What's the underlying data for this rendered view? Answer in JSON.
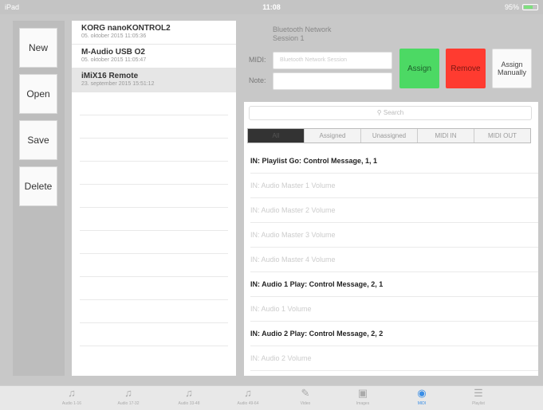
{
  "status": {
    "carrier": "iPad",
    "time": "11:08",
    "battery": "95%"
  },
  "sidebar": {
    "new": "New",
    "open": "Open",
    "save": "Save",
    "delete": "Delete"
  },
  "devices": [
    {
      "name": "KORG nanoKONTROL2",
      "date": "05. oktober 2015 11:05:36"
    },
    {
      "name": "M-Audio USB O2",
      "date": "05. oktober 2015 11:05:47"
    },
    {
      "name": "iMiX16 Remote",
      "date": "23. september 2015 15:51:12"
    }
  ],
  "network": {
    "line1": "Bluetooth Network",
    "line2": "Session 1"
  },
  "fields": {
    "midi_label": "MIDI:",
    "midi_value": "Bluetooth Network Session",
    "note_label": "Note:",
    "note_value": ""
  },
  "buttons": {
    "assign": "Assign",
    "remove": "Remove",
    "assign_manually": "Assign Manually"
  },
  "search": {
    "placeholder": "Search"
  },
  "filters": [
    "All",
    "Assigned",
    "Unassigned",
    "MIDI IN",
    "MIDI OUT"
  ],
  "messages": [
    {
      "text": "IN: Playlist Go: Control Message, 1, 1",
      "assigned": true
    },
    {
      "text": "IN: Audio Master 1 Volume",
      "assigned": false
    },
    {
      "text": "IN: Audio Master 2 Volume",
      "assigned": false
    },
    {
      "text": "IN: Audio Master 3 Volume",
      "assigned": false
    },
    {
      "text": "IN: Audio Master 4 Volume",
      "assigned": false
    },
    {
      "text": "IN: Audio 1 Play: Control Message, 2, 1",
      "assigned": true
    },
    {
      "text": "IN: Audio 1 Volume",
      "assigned": false
    },
    {
      "text": "IN: Audio 2 Play: Control Message, 2, 2",
      "assigned": true
    },
    {
      "text": "IN: Audio 2 Volume",
      "assigned": false
    }
  ],
  "tabs": [
    {
      "label": "Audio 1-16",
      "icon": "music-note-icon"
    },
    {
      "label": "Audio 17-32",
      "icon": "music-note-icon"
    },
    {
      "label": "Audio 33-48",
      "icon": "music-note-icon"
    },
    {
      "label": "Audio 49-64",
      "icon": "music-note-icon"
    },
    {
      "label": "Video",
      "icon": "pencil-box-icon"
    },
    {
      "label": "Images",
      "icon": "image-icon"
    },
    {
      "label": "MIDI",
      "icon": "midi-port-icon"
    },
    {
      "label": "Playlist",
      "icon": "list-icon"
    }
  ],
  "colors": {
    "assign": "#4cd964",
    "remove": "#ff3b30",
    "active_tab": "#3a8ee6"
  }
}
